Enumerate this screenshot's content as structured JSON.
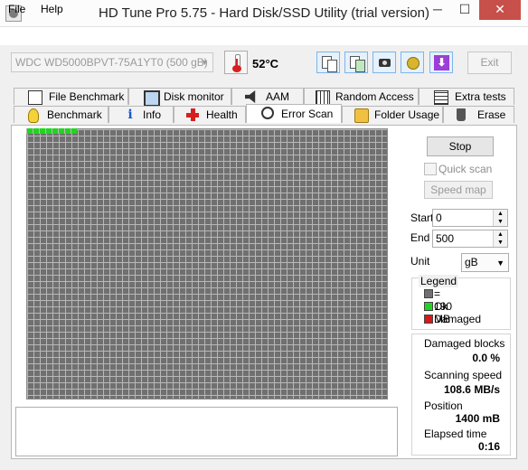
{
  "window": {
    "title": "HD Tune Pro 5.75 - Hard Disk/SSD Utility (trial version)",
    "controls": {
      "minimize": "─",
      "maximize": "☐",
      "close": "✕"
    }
  },
  "menu": {
    "file": "File",
    "help": "Help"
  },
  "toolbar": {
    "drive": "WDC WD5000BPVT-75A1YT0 (500 gB)",
    "temperature": "52°C",
    "exit_label": "Exit",
    "icons": [
      "copy-info-icon",
      "copy-screenshot-icon",
      "camera-icon",
      "options-icon",
      "save-icon"
    ]
  },
  "tabs": {
    "row1": [
      "File Benchmark",
      "Disk monitor",
      "AAM",
      "Random Access",
      "Extra tests"
    ],
    "row2": [
      "Benchmark",
      "Info",
      "Health",
      "Error Scan",
      "Folder Usage",
      "Erase"
    ],
    "active": "Error Scan"
  },
  "scan": {
    "stop_label": "Stop",
    "quick_scan_label": "Quick scan",
    "quick_scan_checked": false,
    "speed_map_label": "Speed map",
    "start_label": "Start",
    "start_value": "0",
    "end_label": "End",
    "end_value": "500",
    "unit_label": "Unit",
    "unit_value": "gB",
    "progress_fraction": 0.0028
  },
  "legend": {
    "title": "Legend",
    "block": "= 190 MB",
    "ok": "Ok",
    "damaged": "Damaged",
    "colors": {
      "block": "#707070",
      "ok": "#22d422",
      "damaged": "#d61a1a"
    }
  },
  "stats": {
    "damaged_blocks_label": "Damaged blocks",
    "damaged_blocks_value": "0.0 %",
    "scanning_speed_label": "Scanning speed",
    "scanning_speed_value": "108.6 MB/s",
    "position_label": "Position",
    "position_value": "1400 mB",
    "elapsed_label": "Elapsed time",
    "elapsed_value": "0:16"
  }
}
